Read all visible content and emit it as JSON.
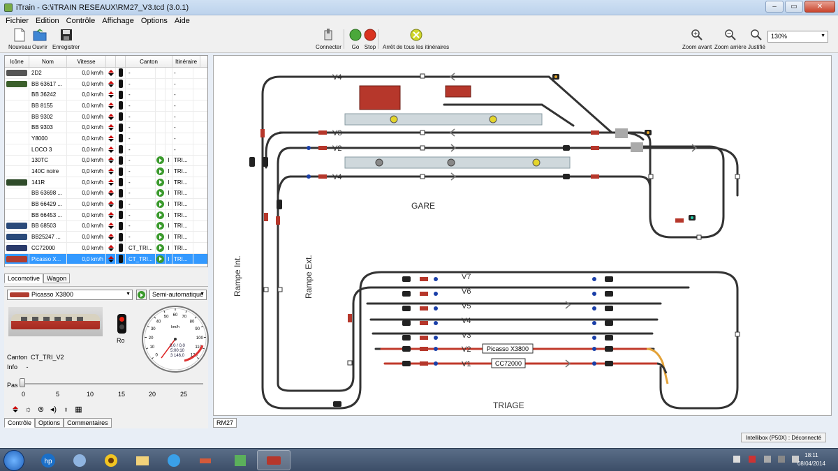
{
  "window": {
    "title": "iTrain - G:\\iTRAIN  RESEAUX\\RM27_V3.tcd (3.0.1)",
    "minimize": "–",
    "maximize": "▭",
    "close": "✕"
  },
  "menu": [
    "Fichier",
    "Edition",
    "Contrôle",
    "Affichage",
    "Options",
    "Aide"
  ],
  "toolbar": {
    "nouveau": "Nouveau",
    "ouvrir": "Ouvrir",
    "enregistrer": "Enregistrer",
    "connecter": "Connecter",
    "go": "Go",
    "stop": "Stop",
    "arret": "Arrêt de tous les itinéraires",
    "zoom_avant": "Zoom avant",
    "zoom_arriere": "Zoom arrière",
    "justifie": "Justifié",
    "zoom_value": "130%"
  },
  "colors": {
    "red_track": "#c0392b",
    "track": "#333333",
    "selection": "#3399ff",
    "accent_green": "#3b9a2d"
  },
  "loco_table": {
    "headers": [
      "Icône",
      "Nom",
      "Vitesse",
      "Canton",
      "Itinéraire"
    ],
    "rows": [
      {
        "name": "2D2",
        "speed": "0,0 km/h",
        "canton": "-",
        "play": false,
        "itin": "-",
        "thumb": "#555"
      },
      {
        "name": "BB 63617 ...",
        "speed": "0,0 km/h",
        "canton": "-",
        "play": false,
        "itin": "-",
        "thumb": "#3a5e2a"
      },
      {
        "name": "BB 36242",
        "speed": "0,0 km/h",
        "canton": "-",
        "play": false,
        "itin": "-",
        "thumb": ""
      },
      {
        "name": "BB 8155",
        "speed": "0,0 km/h",
        "canton": "-",
        "play": false,
        "itin": "-",
        "thumb": ""
      },
      {
        "name": "BB 9302",
        "speed": "0,0 km/h",
        "canton": "-",
        "play": false,
        "itin": "-",
        "thumb": ""
      },
      {
        "name": "BB 9303",
        "speed": "0,0 km/h",
        "canton": "-",
        "play": false,
        "itin": "-",
        "thumb": ""
      },
      {
        "name": "Y8000",
        "speed": "0,0 km/h",
        "canton": "-",
        "play": false,
        "itin": "-",
        "thumb": ""
      },
      {
        "name": "LOCO 3",
        "speed": "0,0 km/h",
        "canton": "-",
        "play": false,
        "itin": "-",
        "thumb": ""
      },
      {
        "name": "130TC",
        "speed": "0,0 km/h",
        "canton": "-",
        "play": true,
        "I": "I",
        "itin": "TRI...",
        "thumb": ""
      },
      {
        "name": "140C noire",
        "speed": "0,0 km/h",
        "canton": "-",
        "play": true,
        "I": "I",
        "itin": "TRI...",
        "thumb": ""
      },
      {
        "name": "141R",
        "speed": "0,0 km/h",
        "canton": "-",
        "play": true,
        "I": "I",
        "itin": "TRI...",
        "thumb": "#2f4b2a"
      },
      {
        "name": "BB 63698 ...",
        "speed": "0,0 km/h",
        "canton": "-",
        "play": true,
        "I": "I",
        "itin": "TRI...",
        "thumb": ""
      },
      {
        "name": "BB 66429 ...",
        "speed": "0,0 km/h",
        "canton": "-",
        "play": true,
        "I": "I",
        "itin": "TRI...",
        "thumb": ""
      },
      {
        "name": "BB 66453 ...",
        "speed": "0,0 km/h",
        "canton": "-",
        "play": true,
        "I": "I",
        "itin": "TRI...",
        "thumb": ""
      },
      {
        "name": "BB 68503",
        "speed": "0,0 km/h",
        "canton": "-",
        "play": true,
        "I": "I",
        "itin": "TRI...",
        "thumb": "#2a4a7a"
      },
      {
        "name": "BB25247 ...",
        "speed": "0,0 km/h",
        "canton": "-",
        "play": true,
        "I": "I",
        "itin": "TRI...",
        "thumb": "#2a4a7a"
      },
      {
        "name": "CC72000",
        "speed": "0,0 km/h",
        "canton": "CT_TRI...",
        "play": true,
        "I": "I",
        "itin": "TRI...",
        "thumb": "#2a3a6a"
      },
      {
        "name": "Picasso X...",
        "speed": "0,0 km/h",
        "canton": "CT_TRI...",
        "play": true,
        "I": "I",
        "itin": "TRI...",
        "thumb": "#b03c30",
        "selected": true
      }
    ]
  },
  "tabs_top": [
    "Locomotive",
    "Wagon"
  ],
  "cockpit": {
    "loco_select": "Picasso X3800",
    "mode_select": "Semi-automatique",
    "signal_label": "Ro",
    "canton_label": "Canton",
    "canton_value": "CT_TRI_V2",
    "info_label": "Info",
    "info_value": "-",
    "pas_label": "Pas",
    "ticks": [
      "0",
      "5",
      "10",
      "15",
      "20",
      "25"
    ],
    "speed_value": 0
  },
  "gauge": {
    "unit": "km/h",
    "ticks": [
      "0",
      "10",
      "20",
      "30",
      "40",
      "50",
      "60",
      "70",
      "80",
      "90",
      "100",
      "110",
      "120"
    ],
    "speed": "0,0 / 0,0",
    "time": "5:00:10",
    "distance": "3 146,0"
  },
  "tabs_bottom": [
    "Contrôle",
    "Options",
    "Commentaires"
  ],
  "layout": {
    "labels": {
      "v4": "V4",
      "v3": "V3",
      "v2": "V2",
      "v4b": "V4",
      "gare": "GARE",
      "rampe_int": "Rampe Int.",
      "rampe_ext": "Rampe Ext.",
      "triage": "TRIAGE",
      "t_v7": "V7",
      "t_v6": "V6",
      "t_v5": "V5",
      "t_v4": "V4",
      "t_v3": "V3",
      "t_v2": "V2",
      "t_v1": "V1"
    },
    "train_labels": [
      "Picasso X3800",
      "CC72000"
    ]
  },
  "layout_tab": "RM27",
  "status": "Intellibox (P50X) : Déconnecté",
  "clock": {
    "time": "18:11",
    "date": "08/04/2014"
  }
}
